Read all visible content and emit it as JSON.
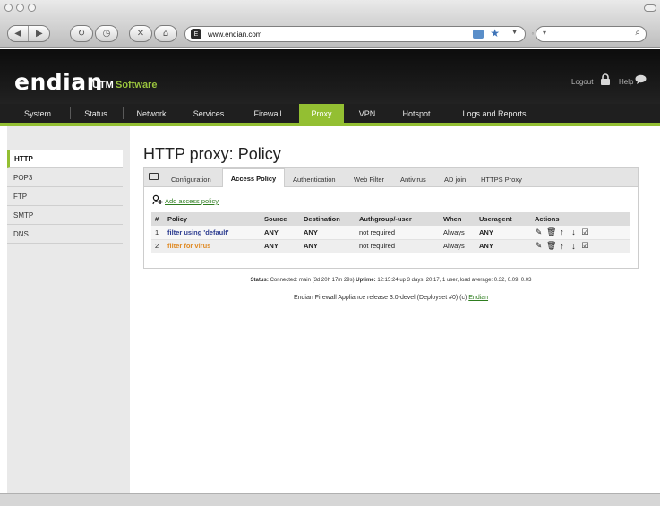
{
  "browser": {
    "url": "www.endian.com",
    "favicon_label": "E",
    "search_dropdown": "▾"
  },
  "header": {
    "logo": "endian",
    "logo_sub_left": "UTM",
    "logo_sub_right": "Software",
    "logout_label": "Logout",
    "help_label": "Help"
  },
  "nav": {
    "items": [
      {
        "label": "System"
      },
      {
        "label": "Status"
      },
      {
        "label": "Network"
      },
      {
        "label": "Services"
      },
      {
        "label": "Firewall"
      },
      {
        "label": "Proxy",
        "active": true
      },
      {
        "label": "VPN"
      },
      {
        "label": "Hotspot"
      },
      {
        "label": "Logs and Reports"
      }
    ]
  },
  "sidebar": {
    "items": [
      {
        "label": "HTTP",
        "active": true
      },
      {
        "label": "POP3"
      },
      {
        "label": "FTP"
      },
      {
        "label": "SMTP"
      },
      {
        "label": "DNS"
      }
    ]
  },
  "page": {
    "title": "HTTP proxy: Policy",
    "tabs": [
      {
        "label": "Configuration"
      },
      {
        "label": "Access Policy",
        "active": true
      },
      {
        "label": "Authentication"
      },
      {
        "label": "Web Filter"
      },
      {
        "label": "Antivirus"
      },
      {
        "label": "AD join"
      },
      {
        "label": "HTTPS Proxy"
      }
    ],
    "add_link": "Add access policy"
  },
  "table": {
    "headers": [
      "#",
      "Policy",
      "Source",
      "Destination",
      "Authgroup/-user",
      "When",
      "Useragent",
      "Actions"
    ],
    "rows": [
      {
        "num": "1",
        "policy": "filter using 'default'",
        "source": "ANY",
        "destination": "ANY",
        "auth": "not required",
        "when": "Always",
        "useragent": "ANY"
      },
      {
        "num": "2",
        "policy": "filter for virus",
        "source": "ANY",
        "destination": "ANY",
        "auth": "not required",
        "when": "Always",
        "useragent": "ANY"
      }
    ],
    "action_icons": [
      "edit-icon",
      "delete-icon",
      "move-up-icon",
      "move-down-icon",
      "enable-checkbox-icon"
    ]
  },
  "status": {
    "status_label": "Status:",
    "status_text": "Connected: main (3d 20h 17m 29s)",
    "uptime_label": "Uptime:",
    "uptime_text": "12:15:24 up 3 days, 20:17, 1 user, load average: 0.32, 0.09, 0.03"
  },
  "footer": {
    "text": "Endian Firewall Appliance release 3.0-devel (Deployset #0) (c)",
    "link": "Endian"
  },
  "colors": {
    "accent_green": "#93bf32",
    "header_bg": "#111111",
    "policy_link_1": "#2b3b8f",
    "policy_link_2": "#e08a24"
  }
}
